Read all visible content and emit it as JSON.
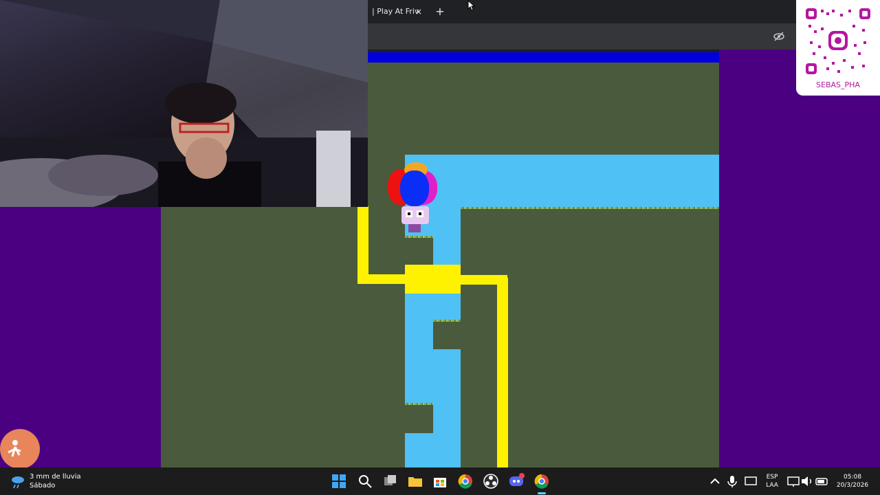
{
  "browser": {
    "tab_title": "| Play At Friv",
    "tab_close": "×",
    "new_tab": "+"
  },
  "overlay": {
    "qr_label": "SEBAS_PHA"
  },
  "taskbar": {
    "weather_line1": "3 mm de lluvia",
    "weather_line2": "Sábado",
    "lang_line1": "ESP",
    "lang_line2": "LAA",
    "time": "05:08",
    "date": "20/3/2026"
  },
  "colors": {
    "background": "#4b0082",
    "game_ground": "#4a5a3c",
    "water": "#4fc1f5",
    "pipe": "#fff200",
    "game_topbar": "#0000dd"
  },
  "icons": {
    "weather": "rain-cloud-icon",
    "start": "windows-start-icon",
    "search": "search-icon",
    "task_view": "task-view-icon",
    "explorer": "file-explorer-icon",
    "store": "store-icon",
    "chrome": "chrome-icon",
    "discord": "discord-icon"
  }
}
